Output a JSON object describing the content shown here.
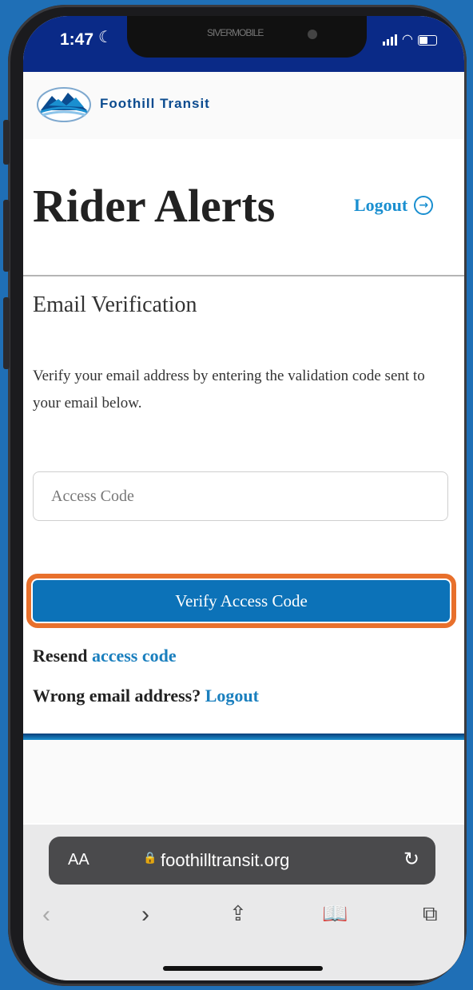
{
  "status_bar": {
    "time": "1:47",
    "moon": "☾",
    "notch_text": "SIVERMOBILE"
  },
  "header": {
    "brand_name": "Foothill Transit"
  },
  "page": {
    "title": "Rider Alerts",
    "logout_label": "Logout"
  },
  "verification": {
    "section_title": "Email Verification",
    "instructions": "Verify your email address by entering the validation code sent to your email below.",
    "access_code_placeholder": "Access Code",
    "verify_button_label": "Verify Access Code",
    "resend_prefix": "Resend",
    "resend_link": "access code",
    "wrong_email_prefix": "Wrong email address?",
    "logout_link": "Logout"
  },
  "browser": {
    "aa_label": "AA",
    "url": "foothilltransit.org",
    "nav_icons": [
      "back-icon",
      "forward-icon",
      "share-icon",
      "bookmarks-icon",
      "tabs-icon"
    ]
  },
  "colors": {
    "status_bar_bg": "#0a2a87",
    "link": "#1a8fd0",
    "button_bg": "#0c72b8",
    "highlight_ring": "#e8702c"
  }
}
